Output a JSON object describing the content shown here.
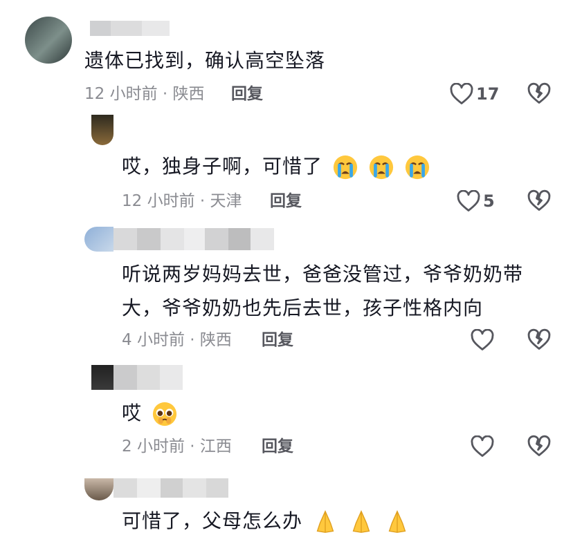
{
  "comments": [
    {
      "text": "遗体已找到，确认高空坠落",
      "time_location": "12 小时前 · 陕西",
      "reply_label": "回复",
      "likes": "17"
    },
    {
      "text": "哎，独身子啊，可惜了",
      "emojis": [
        "crying-face",
        "crying-face",
        "crying-face"
      ],
      "time_location": "12 小时前 · 天津",
      "reply_label": "回复",
      "likes": "5"
    },
    {
      "text_line1": "听说两岁妈妈去世，爸爸没管过，爷爷奶奶带",
      "text_line2": "大，爷爷奶奶也先后去世，孩子性格内向",
      "time_location": "4 小时前 · 陕西",
      "reply_label": "回复",
      "likes": ""
    },
    {
      "text": "哎",
      "emojis": [
        "pleading-face"
      ],
      "time_location": "2 小时前 · 江西",
      "reply_label": "回复",
      "likes": ""
    },
    {
      "text": "可惜了，父母怎么办",
      "emojis": [
        "folded-hands",
        "folded-hands",
        "folded-hands"
      ]
    }
  ],
  "colors": {
    "text": "#161823",
    "meta": "#8a8b91",
    "icon": "#56575e",
    "emoji_yellow": "#ffc83d",
    "tear_blue": "#3aa7e8"
  }
}
